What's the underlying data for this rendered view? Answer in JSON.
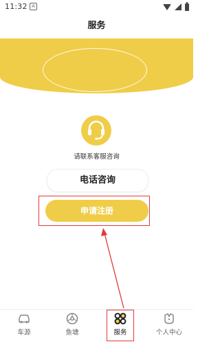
{
  "status_bar": {
    "time": "11:32",
    "notification_glyph": "A"
  },
  "header": {
    "title": "服务"
  },
  "contact": {
    "icon": "headset-icon",
    "text": "请联系客服咨询"
  },
  "buttons": {
    "phone": "电话咨询",
    "register": "申请注册"
  },
  "tabs": [
    {
      "label": "车源",
      "icon": "car-icon",
      "active": false
    },
    {
      "label": "鱼塘",
      "icon": "fishpond-icon",
      "active": false
    },
    {
      "label": "服务",
      "icon": "service-icon",
      "active": true
    },
    {
      "label": "个人中心",
      "icon": "profile-icon",
      "active": false
    }
  ],
  "colors": {
    "accent": "#f0cd48",
    "annotation": "#e03a3a"
  }
}
